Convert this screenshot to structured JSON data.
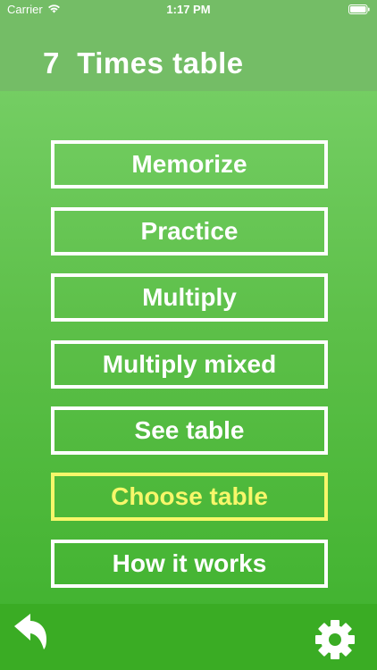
{
  "status_bar": {
    "carrier": "Carrier",
    "time": "1:17 PM",
    "wifi_icon": "wifi-icon",
    "battery_icon": "battery-icon"
  },
  "header": {
    "title": "7  Times table"
  },
  "menu": {
    "items": [
      {
        "label": "Memorize"
      },
      {
        "label": "Practice"
      },
      {
        "label": "Multiply"
      },
      {
        "label": "Multiply mixed"
      },
      {
        "label": "See table"
      },
      {
        "label": "Choose table",
        "selected": true
      },
      {
        "label": "How it works"
      }
    ]
  },
  "toolbar": {
    "back_icon": "back-arrow-icon",
    "settings_icon": "gear-icon"
  },
  "colors": {
    "header_bg": "#74bd66",
    "background_top": "#7dd36d",
    "background_bottom": "#3db12c",
    "button_border": "#ffffff",
    "selected_accent": "#f7f76a",
    "bottom_bar": "#3aac24"
  }
}
